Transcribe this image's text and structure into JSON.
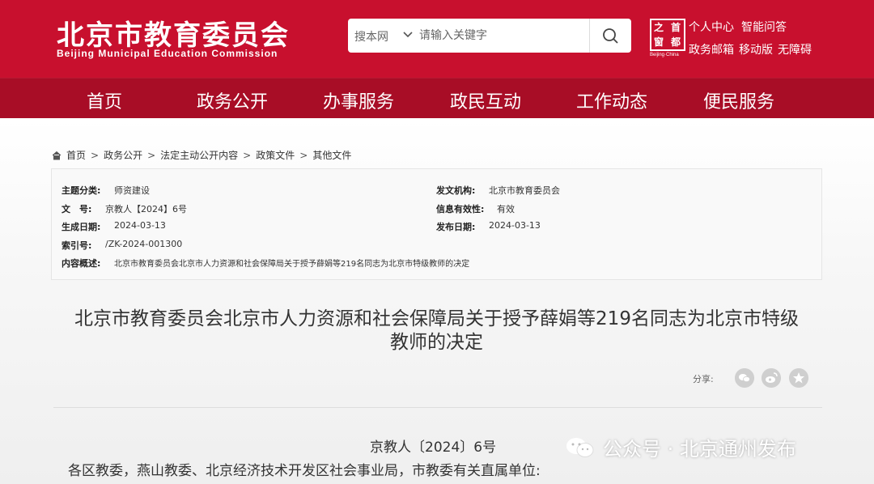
{
  "header": {
    "org_name_cn": "北京市教育委员会",
    "org_name_en": "Beijing Municipal Education Commission",
    "search": {
      "scope": "搜本网",
      "placeholder": "请输入关键字"
    },
    "capital_logo": {
      "glyphs": [
        "首",
        "都",
        "之",
        "窗"
      ],
      "tagline": "Beijing·China"
    },
    "links": {
      "personal_center": "个人中心",
      "smart_qa": "智能问答",
      "gov_mailbox": "政务邮箱",
      "mobile": "移动版",
      "accessibility": "无障碍"
    }
  },
  "nav": {
    "items": [
      "首页",
      "政务公开",
      "办事服务",
      "政民互动",
      "工作动态",
      "便民服务"
    ]
  },
  "breadcrumb": {
    "items": [
      "首页",
      "政务公开",
      "法定主动公开内容",
      "政策文件",
      "其他文件"
    ],
    "separator": ">"
  },
  "meta": {
    "topic_label": "主题分类:",
    "topic_value": "师资建设",
    "issuer_label": "发文机构:",
    "issuer_value": "北京市教育委员会",
    "docno_label": "文　号:",
    "docno_value": "京教人【2024】6号",
    "validity_label": "信息有效性:",
    "validity_value": "有效",
    "created_label": "生成日期:",
    "created_value": "2024-03-13",
    "published_label": "发布日期:",
    "published_value": "2024-03-13",
    "index_label": "索引号:",
    "index_value": "/ZK-2024-001300",
    "summary_label": "内容概述:",
    "summary_value": "北京市教育委员会北京市人力资源和社会保障局关于授予薛娟等219名同志为北京市特级教师的决定"
  },
  "document": {
    "title_line1": "北京市教育委员会北京市人力资源和社会保障局关于授予薛娟等219名同志为北京市特级",
    "title_line2": "教师的决定",
    "share_label": "分享:",
    "doc_number": "京教人〔2024〕6号",
    "recipients": "各区教委，燕山教委、北京经济技术开发区社会事业局，市教委有关直属单位:"
  },
  "watermark": {
    "text": "公众号 · 北京通州发布"
  },
  "colors": {
    "brand_red": "#c8102e",
    "nav_red": "#a80d26"
  }
}
